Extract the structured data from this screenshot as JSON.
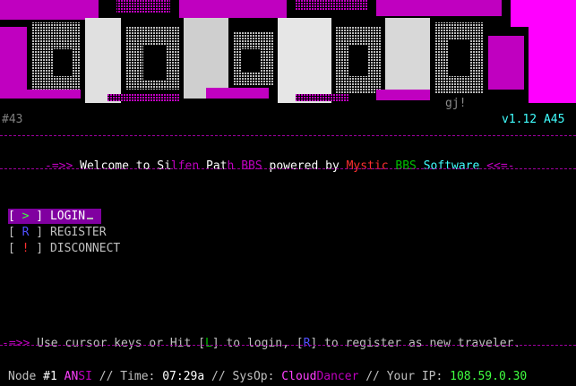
{
  "banner": {
    "signature": "gj!"
  },
  "header": {
    "node_number": "#43",
    "version": "v1.12 A45"
  },
  "welcome": {
    "prefix": "-=>>",
    "welcome_to": "Welcome to",
    "bbs_name_part1": "Si",
    "bbs_name_part2": "lfen",
    "bbs_name_part3": "Pat",
    "bbs_name_part4": "h",
    "bbs_name_part5": "BBS",
    "powered_by": "powered by",
    "software_part1": "Mystic",
    "software_part2": "BBS",
    "software_part3": "Software",
    "suffix": "<<=-"
  },
  "menu": {
    "items": [
      {
        "key": ">",
        "label": "LOGIN"
      },
      {
        "key": "R",
        "label": "REGISTER"
      },
      {
        "key": "!",
        "label": "DISCONNECT"
      }
    ]
  },
  "hint": {
    "prefix": "-=>>",
    "text1": "Use cursor keys or Hit [",
    "key_login": "L",
    "text2": "] to login, [",
    "key_register": "R",
    "text3": "] to register as new traveler."
  },
  "status": {
    "node_label": "Node",
    "node": "#1",
    "term_part1": "AN",
    "term_part2": "SI",
    "time_label": "// Time:",
    "time": "07:29a",
    "sysop_label": "// SysOp:",
    "sysop_part1": "Cloud",
    "sysop_part2": "Dancer",
    "ip_label": "// Your IP:",
    "ip": "108.59.0.30"
  },
  "colors": {
    "background": "#000000",
    "magenta": "#c000c0",
    "selection": "#8000a0",
    "cyan": "#40ffff",
    "green": "#40ff40"
  }
}
